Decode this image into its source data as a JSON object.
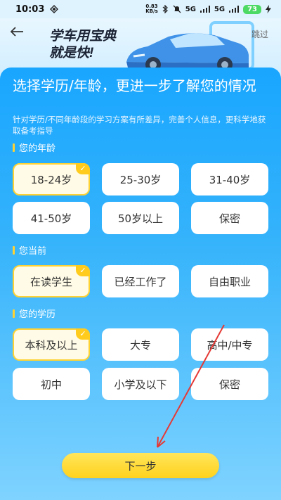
{
  "status_bar": {
    "time": "10:03",
    "speed_value": "0.83",
    "speed_unit": "KB/s",
    "network_1": "5G",
    "network_2": "5G",
    "battery": "73"
  },
  "header": {
    "slogan_line1": "学车用宝典",
    "slogan_line2": "就是快!",
    "skip_label": "跳过"
  },
  "main": {
    "headline": "选择学历/年龄，更进一步了解您的情况",
    "subtext": "针对学历/不同年龄段的学习方案有所差异，完善个人信息，更科学地获取备考指导"
  },
  "sections": [
    {
      "label": "您的年龄",
      "options": [
        "18-24岁",
        "25-30岁",
        "31-40岁",
        "41-50岁",
        "50岁以上",
        "保密"
      ],
      "selected": "18-24岁"
    },
    {
      "label": "您当前",
      "options": [
        "在读学生",
        "已经工作了",
        "自由职业"
      ],
      "selected": "在读学生"
    },
    {
      "label": "您的学历",
      "options": [
        "本科及以上",
        "大专",
        "高中/中专",
        "初中",
        "小学及以下",
        "保密"
      ],
      "selected": "本科及以上"
    }
  ],
  "footer": {
    "next_label": "下一步"
  },
  "colors": {
    "panel_top": "#19a6ff",
    "accent_yellow": "#ffd233",
    "annotation_red": "#e53935"
  }
}
